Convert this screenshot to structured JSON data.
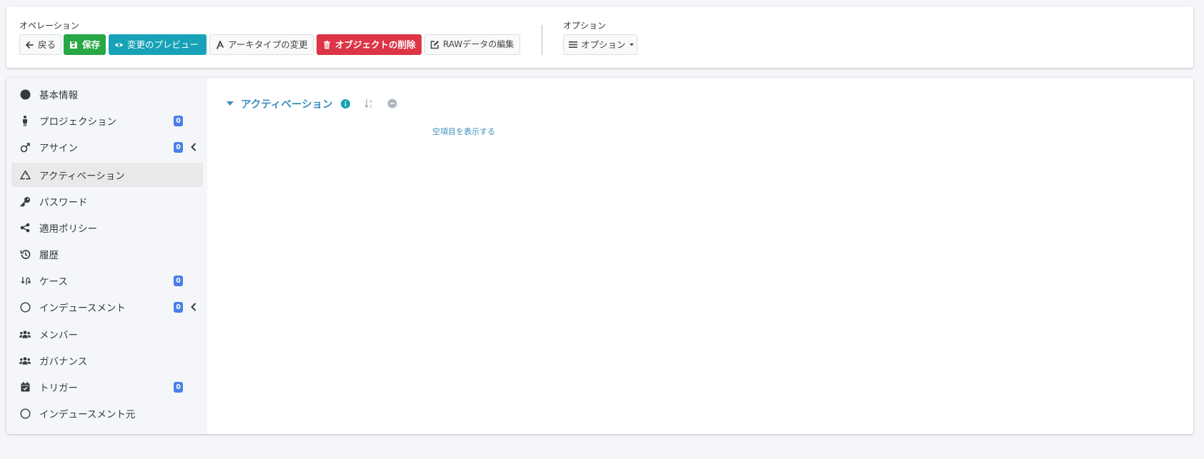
{
  "operations": {
    "group_label": "オペレーション",
    "back_label": "戻る",
    "save_label": "保存",
    "preview_label": "変更のプレビュー",
    "archetype_label": "アーキタイプの変更",
    "delete_label": "オブジェクトの削除",
    "raw_edit_label": "RAWデータの編集"
  },
  "options": {
    "group_label": "オプション",
    "button_label": "オプション"
  },
  "sidebar": {
    "items": [
      {
        "label": "基本情報",
        "icon": "circle-filled-icon",
        "active": false
      },
      {
        "label": "プロジェクション",
        "icon": "person-icon",
        "badge": "0",
        "active": false
      },
      {
        "label": "アサイン",
        "icon": "male-symbol-icon",
        "badge": "0",
        "chevron": true,
        "active": false
      },
      {
        "label": "アクティベーション",
        "icon": "recycle-icon",
        "active": true
      },
      {
        "label": "パスワード",
        "icon": "key-icon",
        "active": false
      },
      {
        "label": "適用ポリシー",
        "icon": "share-nodes-icon",
        "active": false
      },
      {
        "label": "履歴",
        "icon": "history-icon",
        "active": false
      },
      {
        "label": "ケース",
        "icon": "route-icon",
        "badge": "0",
        "active": false
      },
      {
        "label": "インデュースメント",
        "icon": "circle-outline-icon",
        "badge": "0",
        "chevron": true,
        "active": false
      },
      {
        "label": "メンバー",
        "icon": "users-icon",
        "active": false
      },
      {
        "label": "ガバナンス",
        "icon": "users-icon",
        "active": false
      },
      {
        "label": "トリガー",
        "icon": "calendar-check-icon",
        "badge": "0",
        "active": false
      },
      {
        "label": "インデュースメント元",
        "icon": "circle-outline-icon",
        "active": false
      }
    ]
  },
  "content": {
    "section_title": "アクティベーション",
    "show_empty_label": "空項目を表示する"
  },
  "colors": {
    "accent": "#3c8dbc",
    "success": "#28a745",
    "info": "#17a2b8",
    "danger": "#dc3545",
    "badge": "#4a7de8"
  }
}
